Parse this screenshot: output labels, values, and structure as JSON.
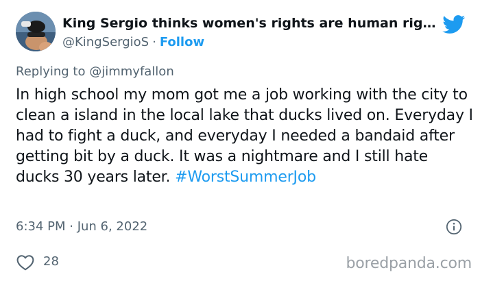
{
  "author": {
    "display_name": "King Sergio thinks women's rights are human rig…",
    "handle": "@KingSergioS",
    "separator": "·",
    "follow_label": "Follow"
  },
  "reply": {
    "prefix": "Replying to",
    "mention": "@jimmyfallon"
  },
  "tweet": {
    "text": "In high school my mom got me a job working with the city to clean a island in the local lake that ducks lived on. Everyday I had to fight a duck, and everyday I needed a bandaid after getting bit by a duck. It was a nightmare and I still hate ducks 30 years later.",
    "hashtag": "#WorstSummerJob",
    "timestamp": "6:34 PM · Jun 6, 2022"
  },
  "engagement": {
    "likes": "28"
  },
  "watermark": "boredpanda.com",
  "icons": {
    "brand": "twitter-bird-icon",
    "info": "info-icon",
    "like": "heart-icon"
  },
  "colors": {
    "accent": "#1d9bf0",
    "muted": "#536471",
    "text": "#0f1419"
  }
}
